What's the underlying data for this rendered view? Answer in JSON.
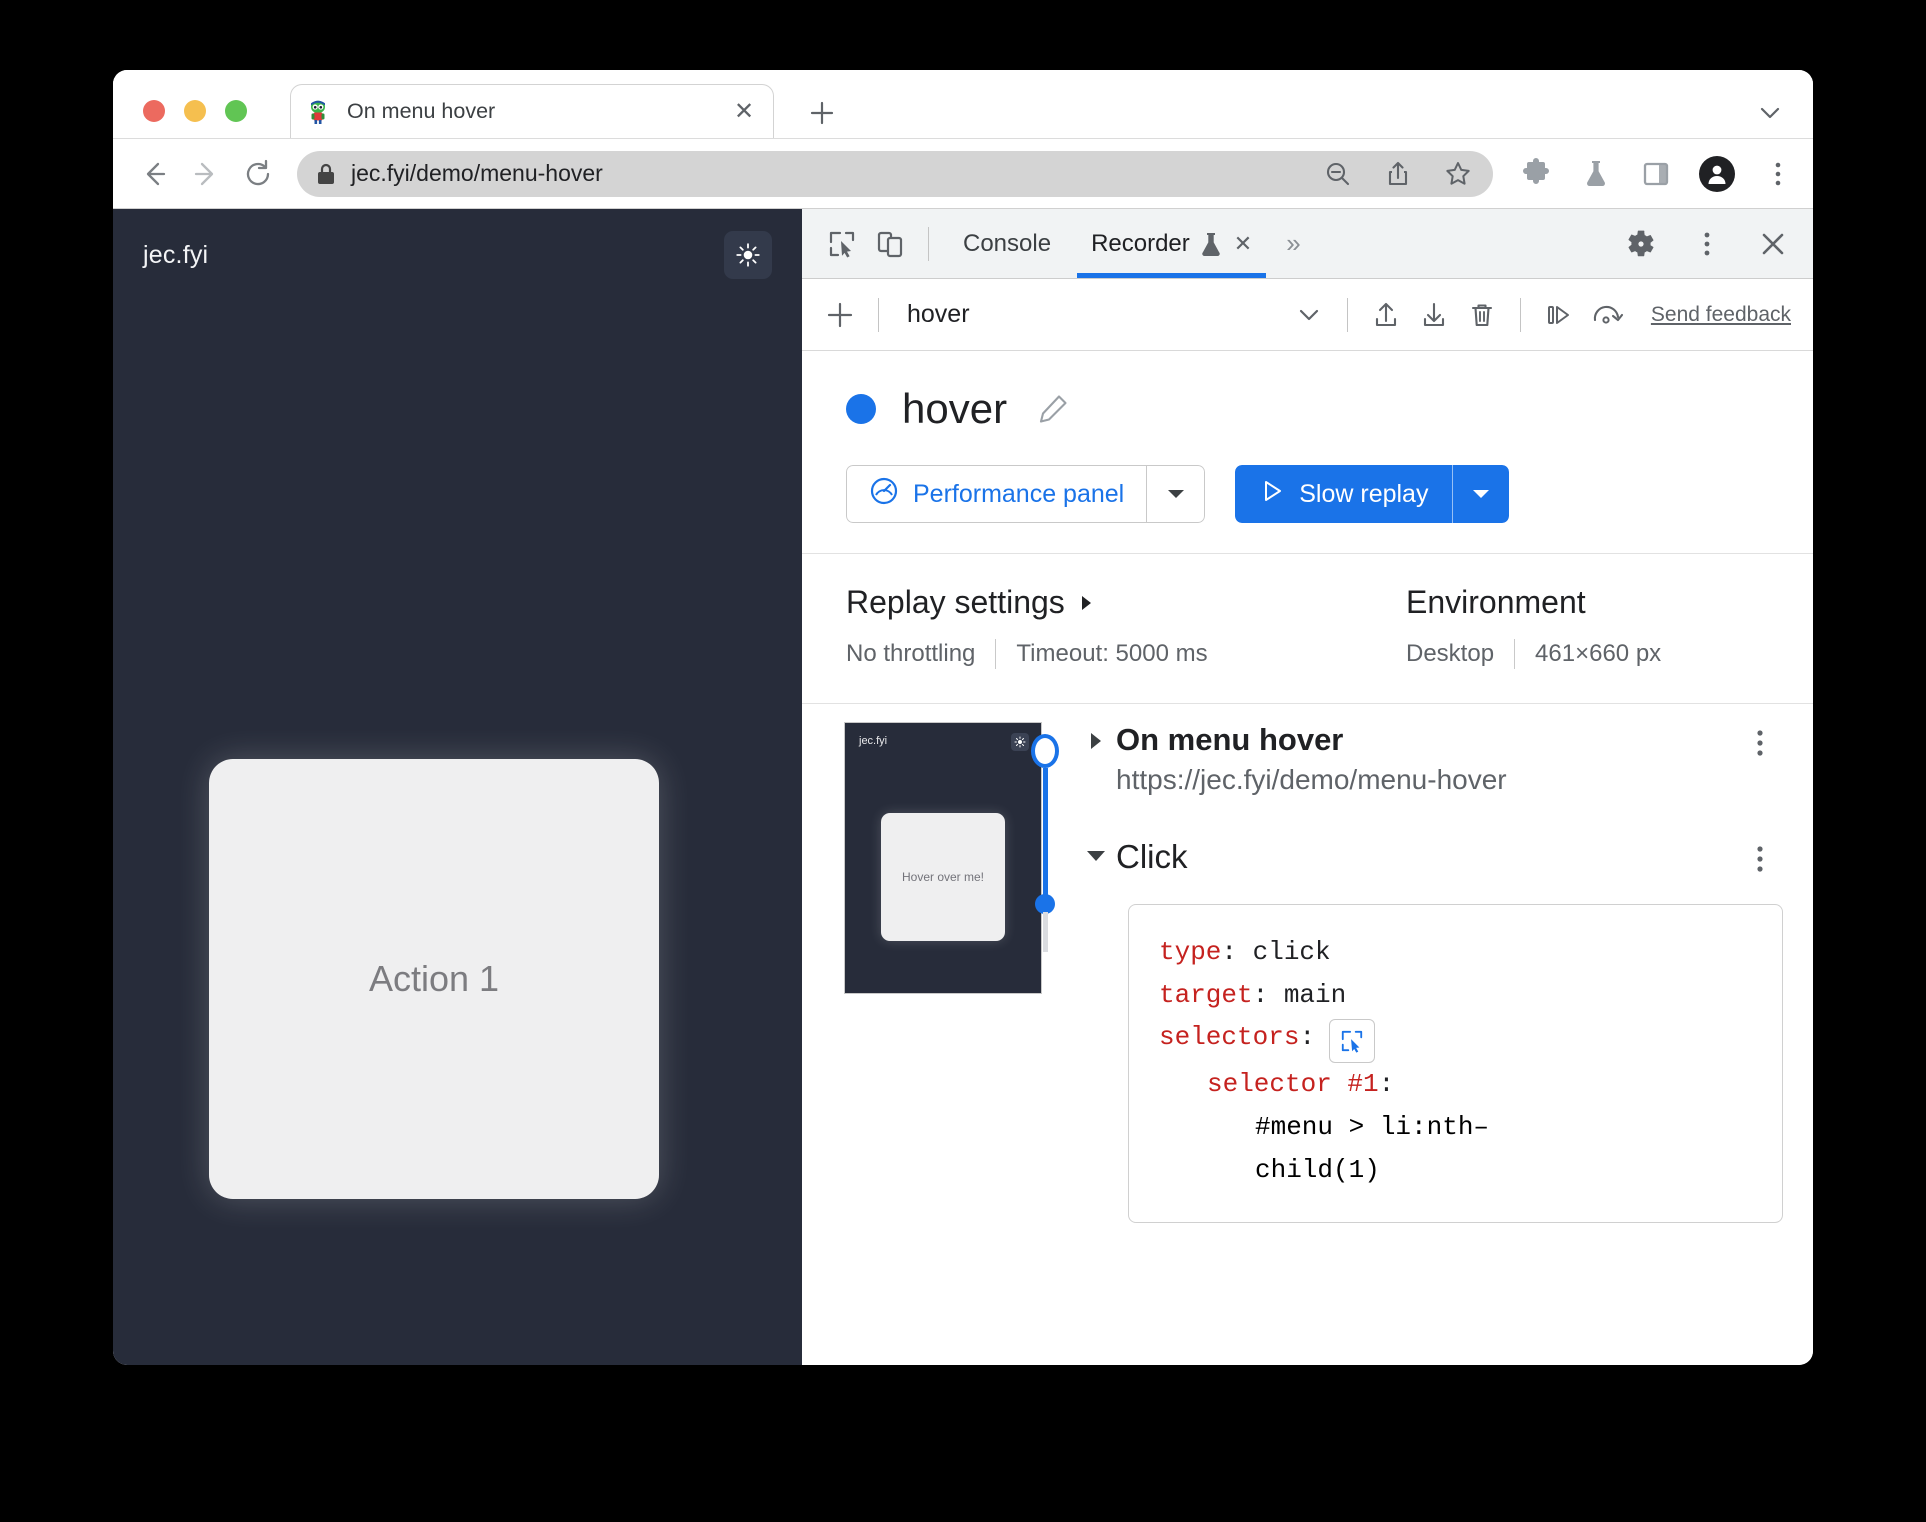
{
  "browser": {
    "tab": {
      "title": "On menu hover",
      "close_label": "✕",
      "favicon": "puzzle-favicon"
    },
    "new_tab_label": "+",
    "omnibox": {
      "url": "jec.fyi/demo/menu-hover",
      "lock_icon": "lock-icon"
    },
    "toolbar_icons": [
      "zoom-out-icon",
      "share-icon",
      "bookmark-star-icon",
      "extensions-puzzle-icon",
      "lab-flask-icon",
      "side-panel-icon",
      "profile-avatar-icon",
      "chrome-menu-icon"
    ]
  },
  "page": {
    "brand": "jec.fyi",
    "theme_toggle_icon": "sun-icon",
    "card_label": "Action 1"
  },
  "devtools": {
    "tabs": [
      {
        "label": "Console",
        "active": false
      },
      {
        "label": "Recorder",
        "active": true,
        "flask_icon": "experiment-flask-icon",
        "close_label": "✕"
      }
    ],
    "more_tabs_label": "»",
    "left_icons": [
      "inspect-element-icon",
      "device-toolbar-icon"
    ],
    "right_icons": [
      "settings-gear-icon",
      "more-options-kebab-icon",
      "close-devtools-icon"
    ]
  },
  "recorder": {
    "toolbar": {
      "add_label": "+",
      "recording_name": "hover",
      "chevron_label": "∨",
      "icons": [
        "import-icon",
        "export-icon",
        "delete-icon",
        "replay-step-icon",
        "replay-retry-icon"
      ],
      "send_feedback": "Send feedback"
    },
    "header": {
      "status_color": "#1a73e8",
      "title": "hover",
      "edit_icon": "pencil-edit-icon",
      "performance_button": "Performance panel",
      "performance_icon": "performance-gauge-icon",
      "performance_caret": "▼",
      "replay_button": "Slow replay",
      "replay_icon": "play-triangle-icon",
      "replay_caret": "▼"
    },
    "settings": {
      "replay_title": "Replay settings",
      "replay_caret": "▶",
      "throttling": "No throttling",
      "timeout": "Timeout: 5000 ms",
      "environment_title": "Environment",
      "device": "Desktop",
      "viewport": "461×660 px"
    },
    "thumbnail": {
      "brand": "jec.fyi",
      "toggle_icon": "sun-icon",
      "card_label": "Hover over me!"
    },
    "steps": [
      {
        "caret": "▶",
        "title": "On menu hover",
        "url": "https://jec.fyi/demo/menu-hover",
        "kebab": "more-options-kebab-icon"
      },
      {
        "caret": "▼",
        "title": "Click",
        "kebab": "more-options-kebab-icon"
      }
    ],
    "code": {
      "type_key": "type",
      "type_value": ": click",
      "target_key": "target",
      "target_value": ": main",
      "selectors_key": "selectors",
      "selectors_colon": ":",
      "selector_picker_icon": "select-element-icon",
      "selector1_key": "selector #1",
      "selector1_colon": ":",
      "selector1_value_line1": "#menu > li:nth–",
      "selector1_value_line2": "child(1)"
    }
  }
}
